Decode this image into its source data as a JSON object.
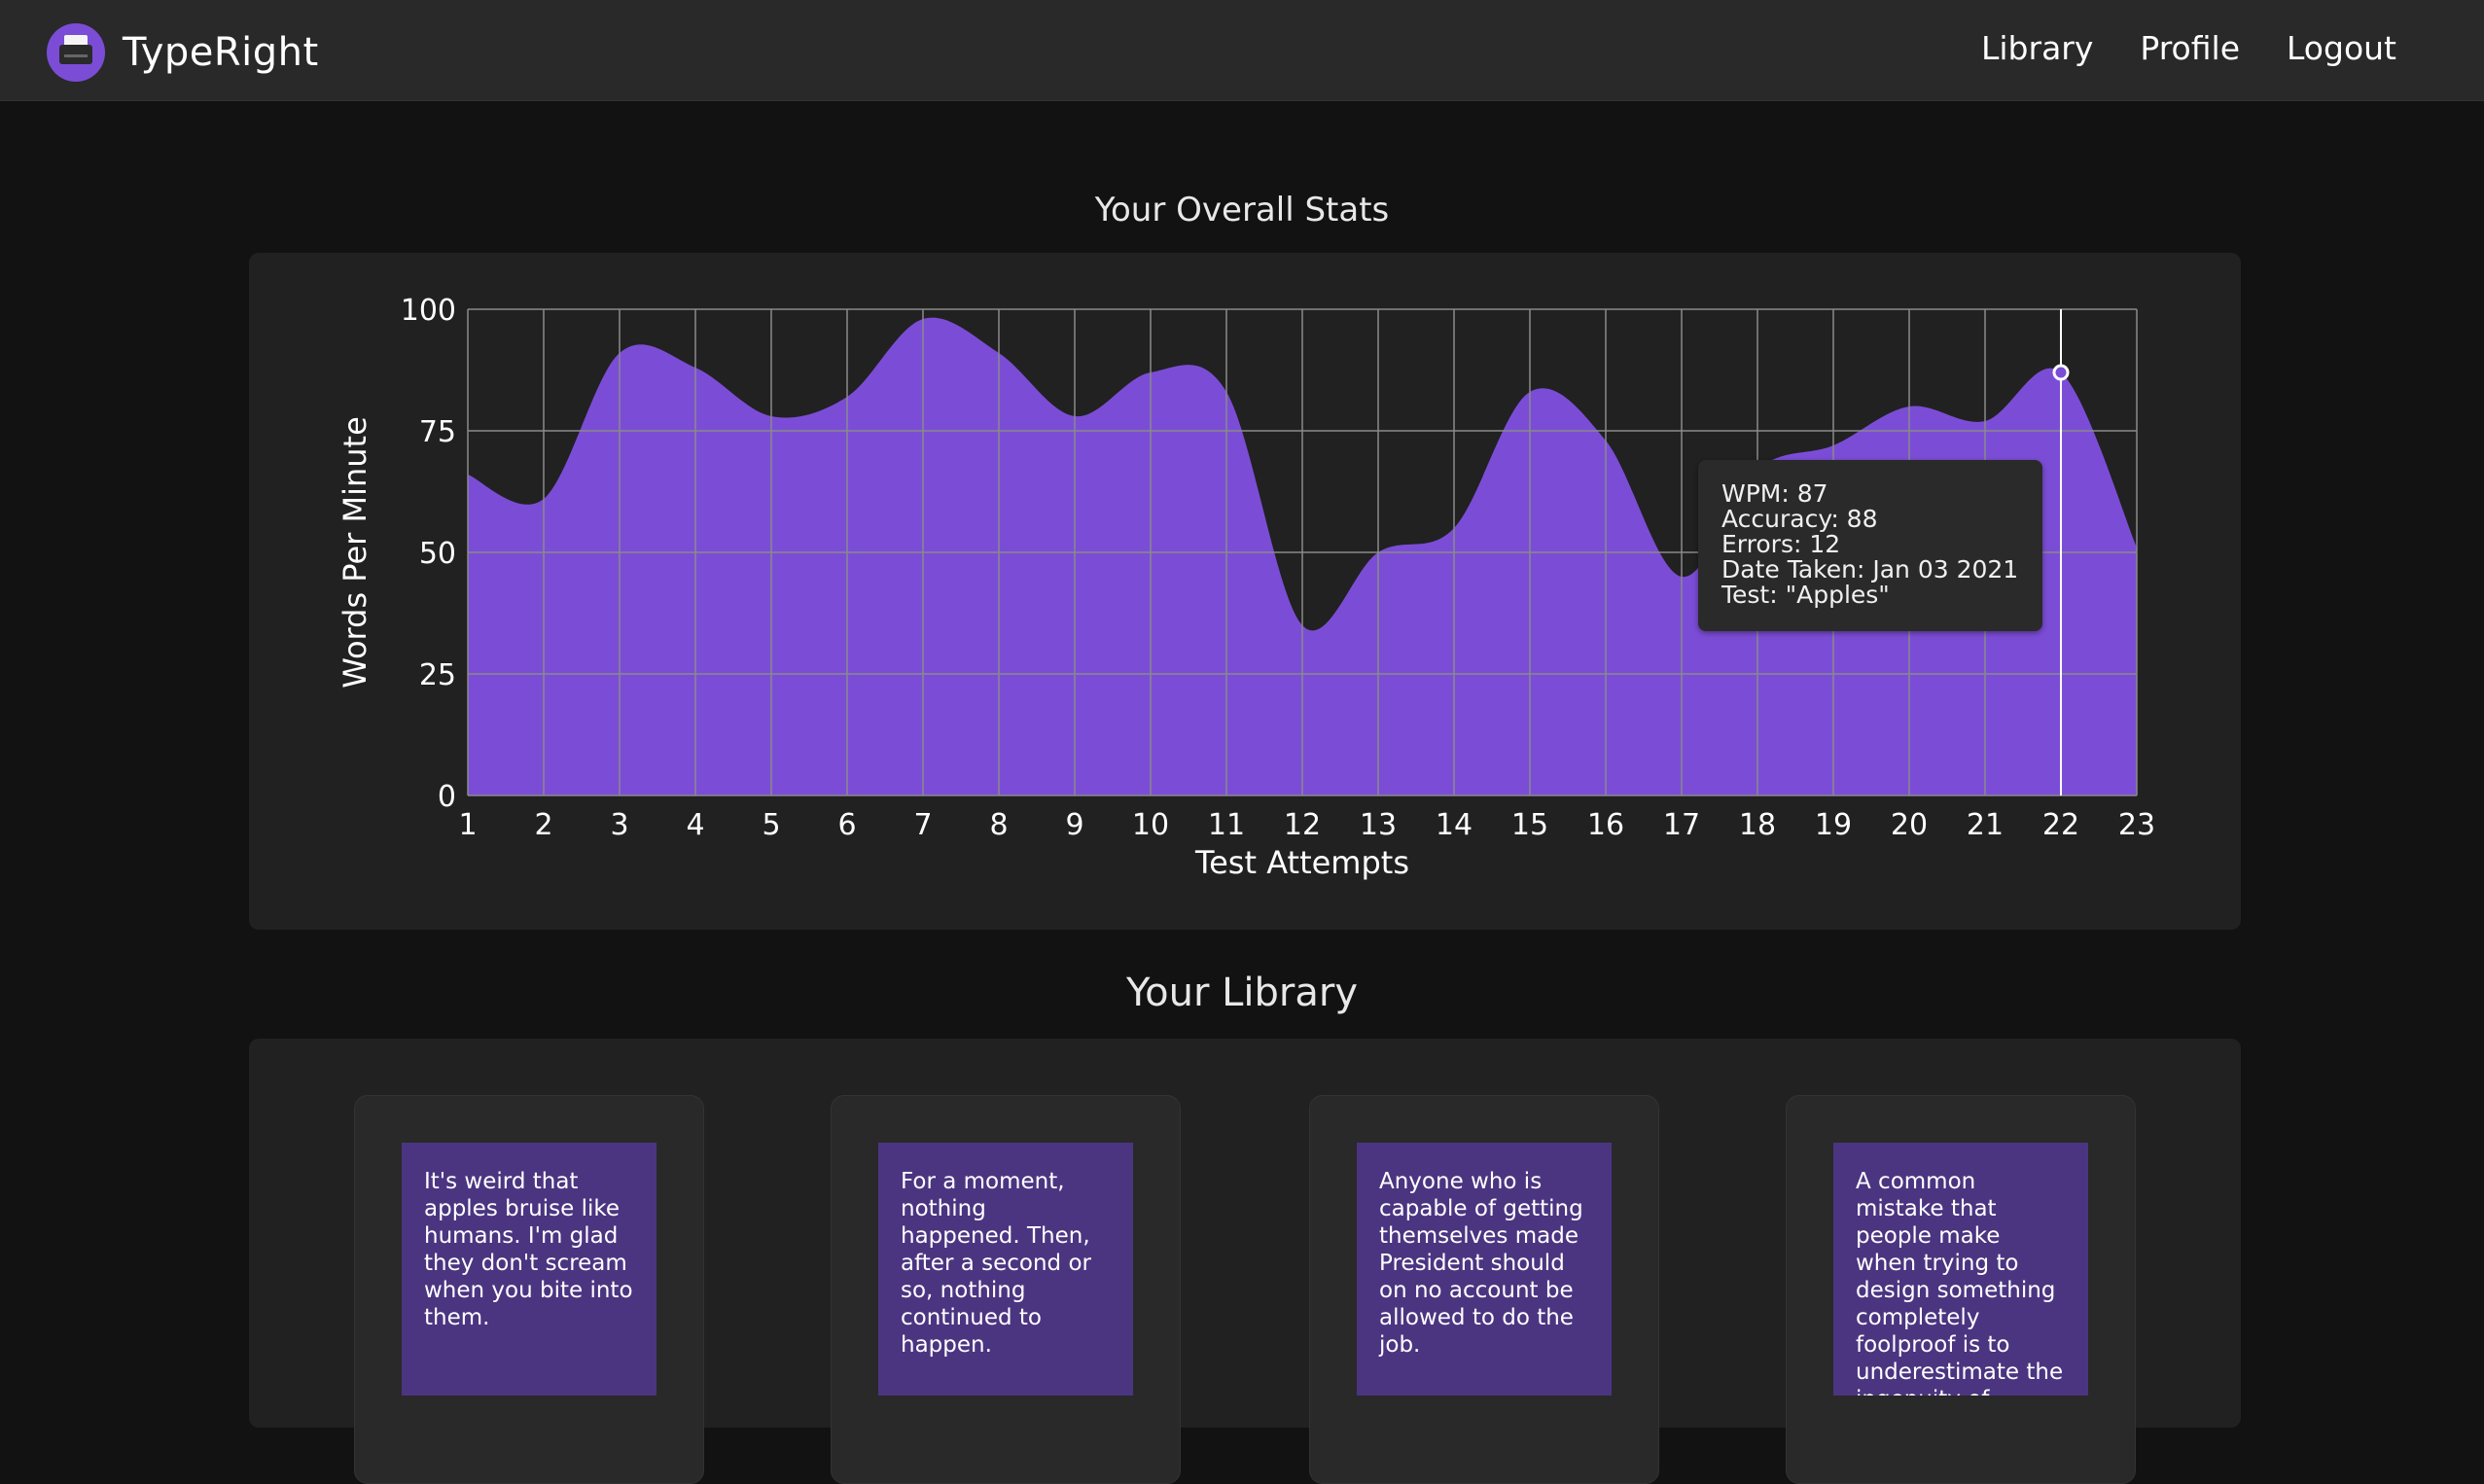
{
  "app": {
    "brand_name": "TypeRight",
    "logo_icon": "typewriter-icon",
    "accent_color": "#7b4dd6"
  },
  "nav": {
    "links": [
      "Library",
      "Profile",
      "Logout"
    ]
  },
  "stats": {
    "title": "Your Overall Stats"
  },
  "chart_data": {
    "type": "area",
    "title": "",
    "xlabel": "Test Attempts",
    "ylabel": "Words Per Minute",
    "x": [
      1,
      2,
      3,
      4,
      5,
      6,
      7,
      8,
      9,
      10,
      11,
      12,
      13,
      14,
      15,
      16,
      17,
      18,
      19,
      20,
      21,
      22,
      23
    ],
    "values": [
      66,
      61,
      91,
      88,
      78,
      82,
      98,
      91,
      78,
      87,
      83,
      35,
      50,
      55,
      83,
      73,
      45,
      67,
      72,
      80,
      77,
      87,
      51
    ],
    "ylim": [
      0,
      100
    ],
    "yticks": [
      0,
      25,
      50,
      75,
      100
    ],
    "grid": true,
    "fill_color": "#7b4dd6",
    "highlighted_point": 22
  },
  "tooltip": {
    "lines": [
      "WPM: 87",
      "Accuracy: 88",
      "Errors: 12",
      "Date Taken: Jan 03 2021",
      "Test: \"Apples\""
    ]
  },
  "library": {
    "title": "Your Library",
    "cards": [
      {
        "text": "It's weird that apples bruise like humans. I'm glad they don't scream when you bite into them."
      },
      {
        "text": "For a moment, nothing happened. Then, after a second or so, nothing continued to happen."
      },
      {
        "text": "Anyone who is capable of getting themselves made President should on no account be allowed to do the job."
      },
      {
        "text": "A common mistake that people make when trying to design something completely foolproof is to underestimate the ingenuity of complete fools."
      }
    ]
  }
}
